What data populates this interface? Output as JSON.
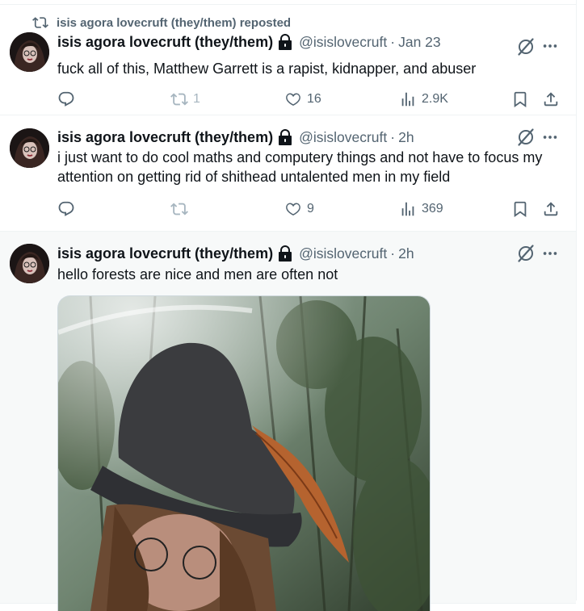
{
  "repost_banner": "isis agora lovecruft (they/them) reposted",
  "tweets": [
    {
      "name": "isis agora lovecruft (they/them)",
      "handle": "@isislovecruft",
      "time": "Jan 23",
      "text": "fuck all of this, Matthew Garrett is a rapist, kidnapper, and abuser",
      "replies": "",
      "reposts": "1",
      "likes": "16",
      "views": "2.9K",
      "icon": "repost-icon"
    },
    {
      "name": "isis agora lovecruft (they/them)",
      "handle": "@isislovecruft",
      "time": "2h",
      "text": "i just want to do cool maths and computery things and not have to focus my attention on getting rid of shithead untalented men in my field",
      "replies": "",
      "reposts": "",
      "likes": "9",
      "views": "369"
    },
    {
      "name": "isis agora lovecruft (they/them)",
      "handle": "@isislovecruft",
      "time": "2h",
      "text": "hello forests are nice and men are often not"
    }
  ],
  "colors": {
    "text": "#0f1419",
    "secondary": "#536471",
    "border": "#eff3f4",
    "hover_bg": "#f7f9f9"
  },
  "icons": [
    "reply-icon",
    "repost-icon",
    "like-icon",
    "views-icon",
    "bookmark-icon",
    "share-icon",
    "grok-icon",
    "more-icon",
    "lock-icon"
  ]
}
